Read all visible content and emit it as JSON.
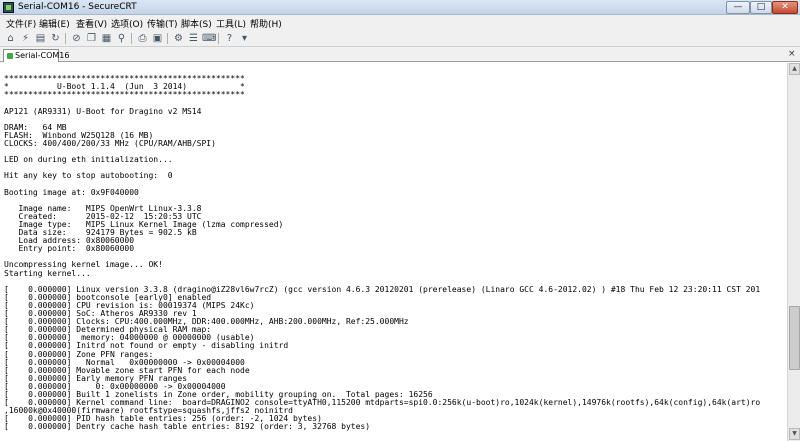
{
  "window": {
    "title": "Serial-COM16 - SecureCRT",
    "minimize_label": "—",
    "maximize_label": "□",
    "close_label": "✕"
  },
  "menu": [
    "文件(F)",
    "编辑(E)",
    "查看(V)",
    "选项(O)",
    "传输(T)",
    "脚本(S)",
    "工具(L)",
    "帮助(H)"
  ],
  "toolbar": {
    "icons": [
      "connect-icon",
      "quick-connect-icon",
      "connect-tab-icon",
      "reconnect-icon",
      "disconnect-icon",
      "copy-icon",
      "paste-icon",
      "find-icon",
      "print-icon",
      "print-setup-icon",
      "session-options-icon",
      "global-options-icon",
      "keymap-icon",
      "help-icon",
      "more-icon"
    ]
  },
  "tab": {
    "label": "Serial-COM16",
    "close_label": "×"
  },
  "terminal": {
    "lines": [
      "",
      "**************************************************",
      "*          U-Boot 1.1.4  (Jun  3 2014)           *",
      "**************************************************",
      "",
      "AP121 (AR9331) U-Boot for Dragino v2 MS14",
      "",
      "DRAM:   64 MB",
      "FLASH:  Winbond W25Q128 (16 MB)",
      "CLOCKS: 400/400/200/33 MHz (CPU/RAM/AHB/SPI)",
      "",
      "LED on during eth initialization...",
      "",
      "Hit any key to stop autobooting:  0",
      "",
      "Booting image at: 0x9F040000",
      "",
      "   Image name:   MIPS OpenWrt Linux-3.3.8",
      "   Created:      2015-02-12  15:20:53 UTC",
      "   Image type:   MIPS Linux Kernel Image (lzma compressed)",
      "   Data size:    924179 Bytes = 902.5 kB",
      "   Load address: 0x80060000",
      "   Entry point:  0x80060000",
      "",
      "Uncompressing kernel image... OK!",
      "Starting kernel...",
      "",
      "[    0.000000] Linux version 3.3.8 (dragino@iZ28vl6w7rcZ) (gcc version 4.6.3 20120201 (prerelease) (Linaro GCC 4.6-2012.02) ) #18 Thu Feb 12 23:20:11 CST 201",
      "[    0.000000] bootconsole [early0] enabled",
      "[    0.000000] CPU revision is: 00019374 (MIPS 24Kc)",
      "[    0.000000] SoC: Atheros AR9330 rev 1",
      "[    0.000000] Clocks: CPU:400.000MHz, DDR:400.000MHz, AHB:200.000MHz, Ref:25.000MHz",
      "[    0.000000] Determined physical RAM map:",
      "[    0.000000]  memory: 04000000 @ 00000000 (usable)",
      "[    0.000000] Initrd not found or empty - disabling initrd",
      "[    0.000000] Zone PFN ranges:",
      "[    0.000000]   Normal   0x00000000 -> 0x00004000",
      "[    0.000000] Movable zone start PFN for each node",
      "[    0.000000] Early memory PFN ranges",
      "[    0.000000]     0: 0x00000000 -> 0x00004000",
      "[    0.000000] Built 1 zonelists in Zone order, mobility grouping on.  Total pages: 16256",
      "[    0.000000] Kernel command line:  board=DRAGINO2 console=ttyATH0,115200 mtdparts=spi0.0:256k(u-boot)ro,1024k(kernel),14976k(rootfs),64k(config),64k(art)ro",
      ",16000k@0x40000(firmware) rootfstype=squashfs,jffs2 noinitrd",
      "[    0.000000] PID hash table entries: 256 (order: -2, 1024 bytes)",
      "[    0.000000] Dentry cache hash table entries: 8192 (order: 3, 32768 bytes)"
    ]
  },
  "scrollbar": {
    "up_label": "▲",
    "down_label": "▼",
    "position_fraction": 0.8
  }
}
